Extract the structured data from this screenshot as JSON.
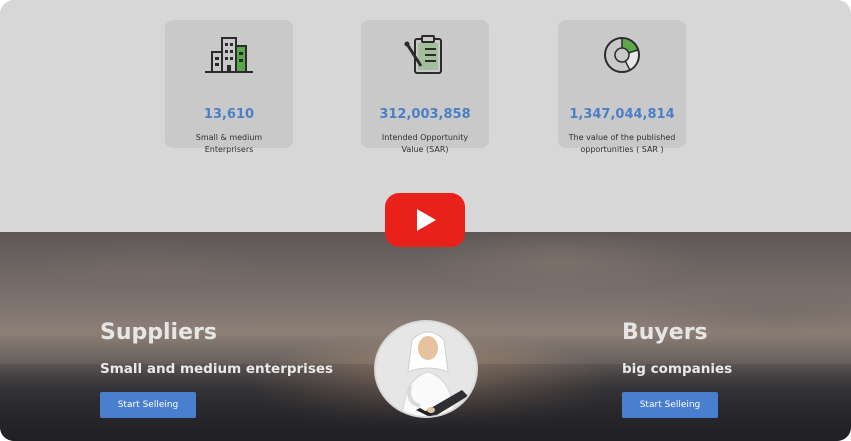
{
  "stats": [
    {
      "value": "13,610",
      "label_line1": "Small & medium",
      "label_line2": "Enterprisers",
      "icon": "buildings-icon"
    },
    {
      "value": "312,003,858",
      "label_line1": "Intended Opportunity",
      "label_line2": "Value (SAR)",
      "icon": "clipboard-icon"
    },
    {
      "value": "1,347,044,814",
      "label_line1": "The value of the published",
      "label_line2": "opportunities ( SAR )",
      "icon": "pie-chart-icon"
    }
  ],
  "video": {
    "play_icon": "play-icon",
    "play_color": "#e8211b"
  },
  "suppliers": {
    "title": "Suppliers",
    "subtitle": "Small and medium enterprises",
    "button": "Start Selleing"
  },
  "buyers": {
    "title": "Buyers",
    "subtitle": "big companies",
    "button": "Start Selleing"
  },
  "colors": {
    "accent": "#4a7fd0",
    "stat_value": "#4a7fc8"
  }
}
